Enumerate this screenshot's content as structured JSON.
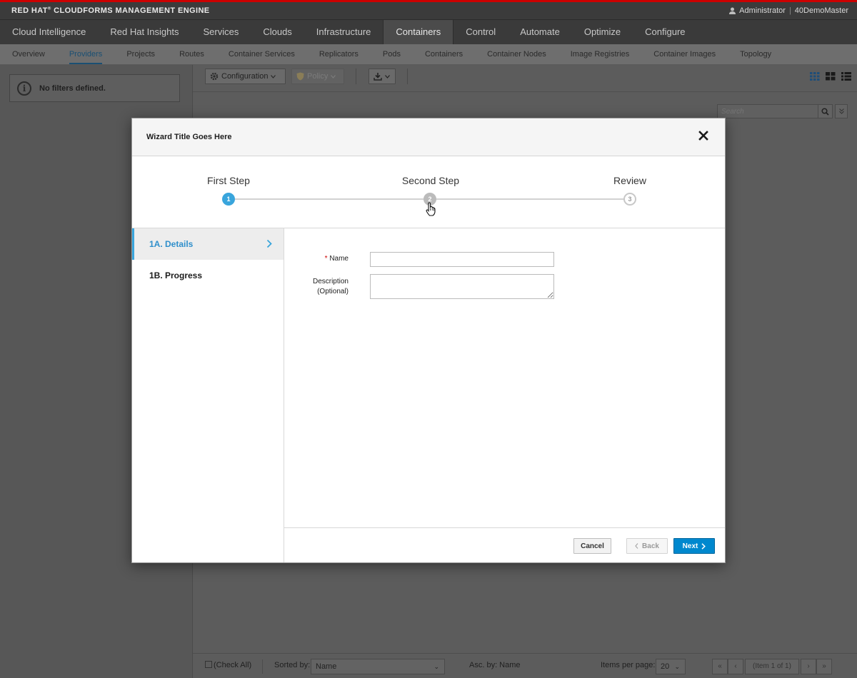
{
  "masthead": {
    "brand": "RED HAT",
    "brand_mark": "®",
    "brand_rest": "CLOUDFORMS MANAGEMENT ENGINE",
    "user": "Administrator",
    "separator": "|",
    "server": "40DemoMaster"
  },
  "primary_nav": {
    "items": [
      {
        "label": "Cloud Intelligence"
      },
      {
        "label": "Red Hat Insights"
      },
      {
        "label": "Services"
      },
      {
        "label": "Clouds"
      },
      {
        "label": "Infrastructure"
      },
      {
        "label": "Containers"
      },
      {
        "label": "Control"
      },
      {
        "label": "Automate"
      },
      {
        "label": "Optimize"
      },
      {
        "label": "Configure"
      }
    ],
    "active": "Containers"
  },
  "secondary_nav": {
    "items": [
      {
        "label": "Overview"
      },
      {
        "label": "Providers"
      },
      {
        "label": "Projects"
      },
      {
        "label": "Routes"
      },
      {
        "label": "Container Services"
      },
      {
        "label": "Replicators"
      },
      {
        "label": "Pods"
      },
      {
        "label": "Containers"
      },
      {
        "label": "Container Nodes"
      },
      {
        "label": "Image Registries"
      },
      {
        "label": "Container Images"
      },
      {
        "label": "Topology"
      }
    ],
    "active": "Providers"
  },
  "sidebar": {
    "filter_text": "No filters defined."
  },
  "toolbar": {
    "configuration_label": "Configuration",
    "policy_label": "Policy",
    "search_placeholder": "Search"
  },
  "bottombar": {
    "check_all_label": "(Check All)",
    "sorted_by_label": "Sorted by:",
    "sorted_by_value": "Name",
    "order_label": "Asc. by: Name",
    "items_per_page_label": "Items per page:",
    "items_per_page_value": "20",
    "page_info": "(Item 1 of 1)"
  },
  "wizard": {
    "title": "Wizard Title Goes Here",
    "steps": [
      {
        "label": "First Step",
        "number": "1",
        "state": "active"
      },
      {
        "label": "Second Step",
        "number": "2",
        "state": "hover"
      },
      {
        "label": "Review",
        "number": "3",
        "state": "pending"
      }
    ],
    "substeps": [
      {
        "label": "1A. Details",
        "active": true
      },
      {
        "label": "1B. Progress",
        "active": false
      }
    ],
    "form": {
      "required_mark": "*",
      "name_label": "Name",
      "name_value": "",
      "description_label": "Description",
      "description_sub": "(Optional)",
      "description_value": ""
    },
    "buttons": {
      "cancel": "Cancel",
      "back": "Back",
      "next": "Next"
    }
  },
  "colors": {
    "accent": "#39a5dc",
    "primary_button": "#0088ce",
    "masthead_border": "#cc0000"
  }
}
